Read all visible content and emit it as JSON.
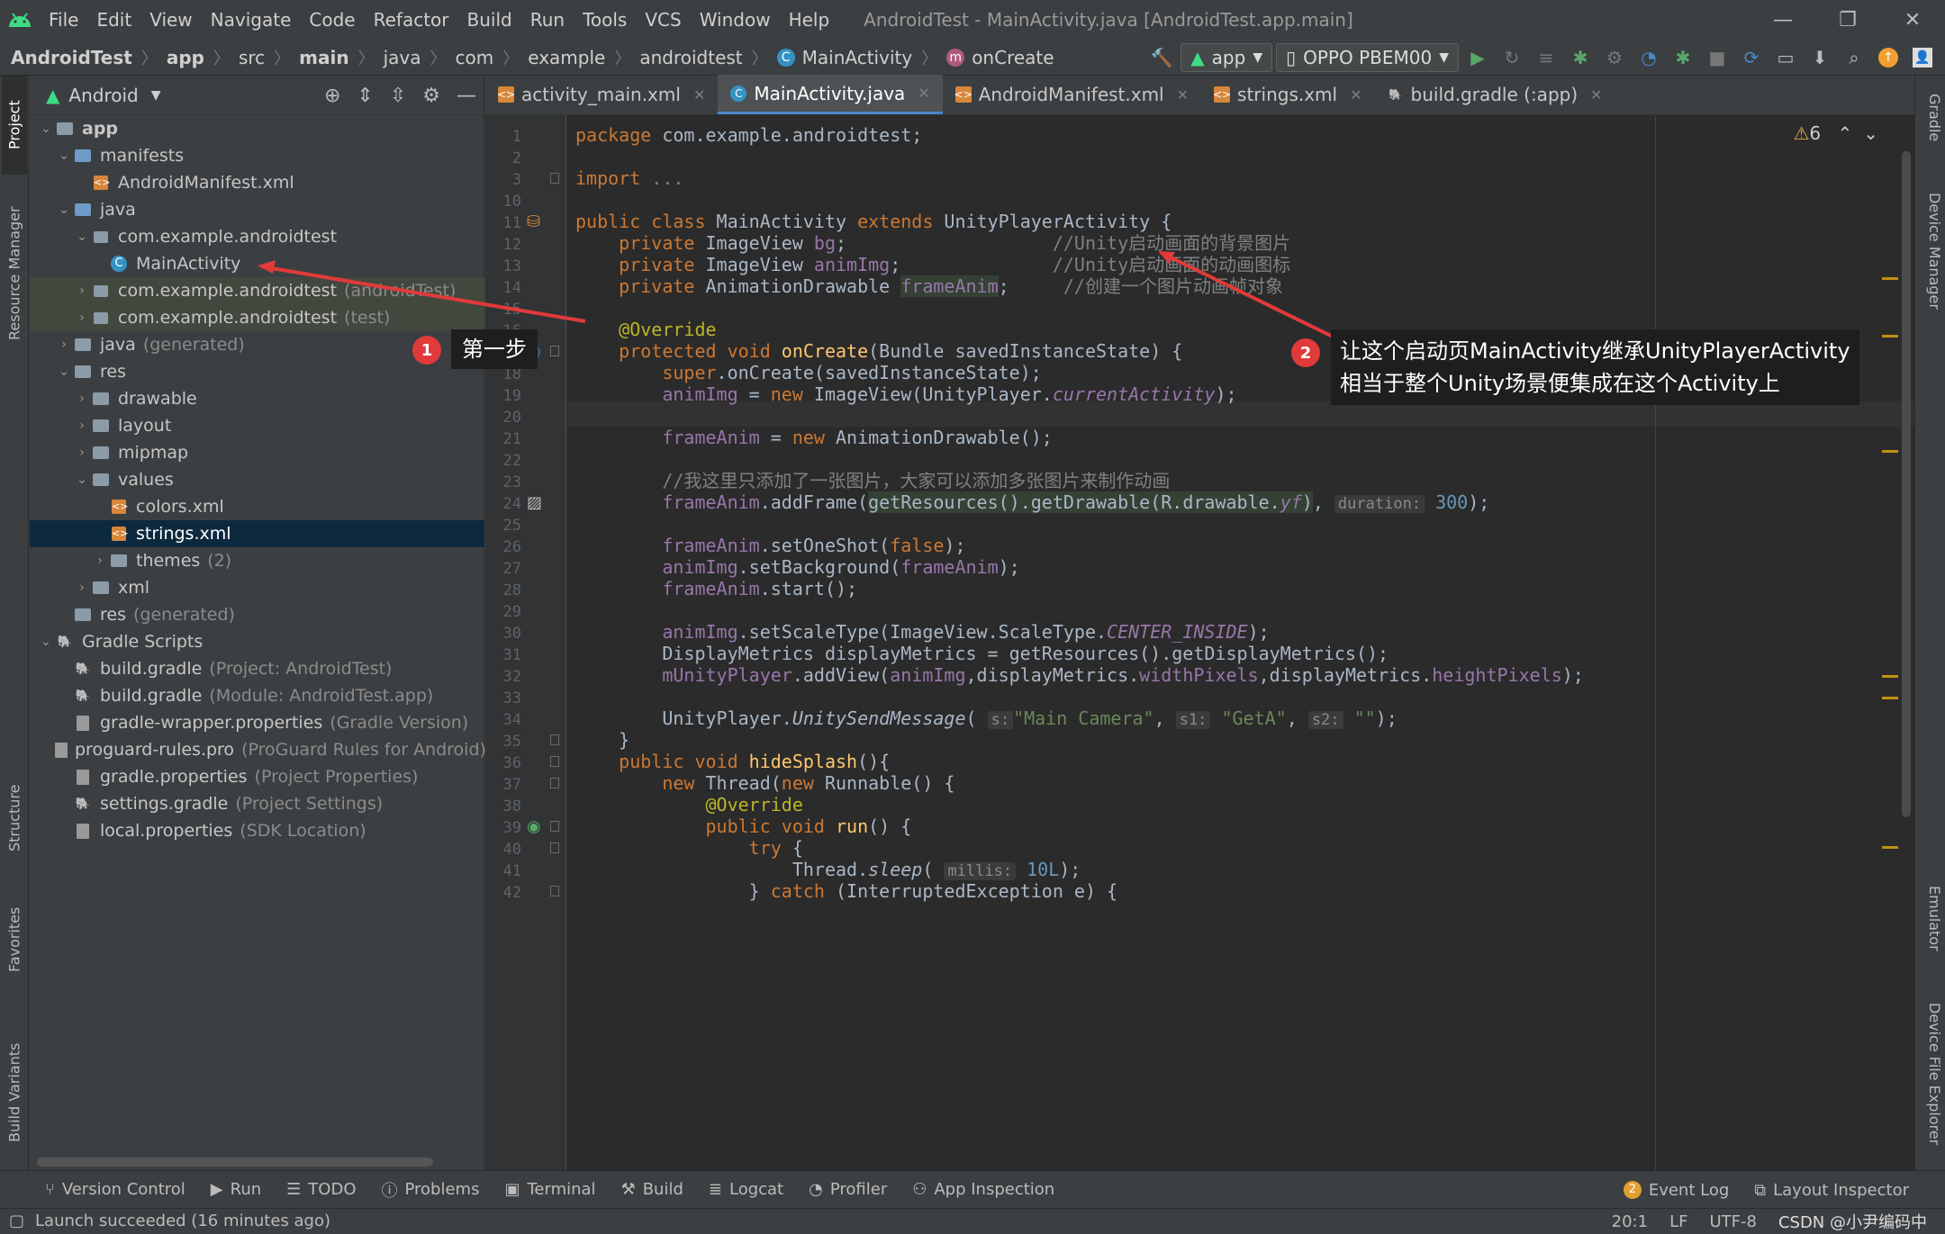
{
  "menubar": {
    "items": [
      "File",
      "Edit",
      "View",
      "Navigate",
      "Code",
      "Refactor",
      "Build",
      "Run",
      "Tools",
      "VCS",
      "Window",
      "Help"
    ],
    "window_title": "AndroidTest - MainActivity.java [AndroidTest.app.main]"
  },
  "breadcrumb": [
    "AndroidTest",
    "app",
    "src",
    "main",
    "java",
    "com",
    "example",
    "androidtest",
    "MainActivity",
    "onCreate"
  ],
  "toolbar": {
    "config": "app",
    "device": "OPPO PBEM00"
  },
  "project": {
    "view": "Android",
    "tree": [
      {
        "label": "app",
        "indent": 0,
        "arrow": "v",
        "icon": "folder",
        "bold": true
      },
      {
        "label": "manifests",
        "indent": 1,
        "arrow": "v",
        "icon": "folder-blue"
      },
      {
        "label": "AndroidManifest.xml",
        "indent": 2,
        "arrow": "",
        "icon": "xml"
      },
      {
        "label": "java",
        "indent": 1,
        "arrow": "v",
        "icon": "folder-blue"
      },
      {
        "label": "com.example.androidtest",
        "indent": 2,
        "arrow": "v",
        "icon": "package"
      },
      {
        "label": "MainActivity",
        "indent": 3,
        "arrow": "",
        "icon": "class"
      },
      {
        "label": "com.example.androidtest",
        "dim": "(androidTest)",
        "indent": 2,
        "arrow": ">",
        "icon": "package",
        "hl": true
      },
      {
        "label": "com.example.androidtest",
        "dim": "(test)",
        "indent": 2,
        "arrow": ">",
        "icon": "package",
        "hl": true
      },
      {
        "label": "java",
        "dim": "(generated)",
        "indent": 1,
        "arrow": ">",
        "icon": "folder"
      },
      {
        "label": "res",
        "indent": 1,
        "arrow": "v",
        "icon": "folder"
      },
      {
        "label": "drawable",
        "indent": 2,
        "arrow": ">",
        "icon": "folder"
      },
      {
        "label": "layout",
        "indent": 2,
        "arrow": ">",
        "icon": "folder"
      },
      {
        "label": "mipmap",
        "indent": 2,
        "arrow": ">",
        "icon": "folder"
      },
      {
        "label": "values",
        "indent": 2,
        "arrow": "v",
        "icon": "folder"
      },
      {
        "label": "colors.xml",
        "indent": 3,
        "arrow": "",
        "icon": "xml"
      },
      {
        "label": "strings.xml",
        "indent": 3,
        "arrow": "",
        "icon": "xml",
        "sel": true
      },
      {
        "label": "themes",
        "dim": "(2)",
        "indent": 3,
        "arrow": ">",
        "icon": "folder"
      },
      {
        "label": "xml",
        "indent": 2,
        "arrow": ">",
        "icon": "folder"
      },
      {
        "label": "res",
        "dim": "(generated)",
        "indent": 1,
        "arrow": "",
        "icon": "folder"
      },
      {
        "label": "Gradle Scripts",
        "indent": 0,
        "arrow": "v",
        "icon": "gradle"
      },
      {
        "label": "build.gradle",
        "dim": "(Project: AndroidTest)",
        "indent": 1,
        "arrow": "",
        "icon": "gradle"
      },
      {
        "label": "build.gradle",
        "dim": "(Module: AndroidTest.app)",
        "indent": 1,
        "arrow": "",
        "icon": "gradle"
      },
      {
        "label": "gradle-wrapper.properties",
        "dim": "(Gradle Version)",
        "indent": 1,
        "arrow": "",
        "icon": "props"
      },
      {
        "label": "proguard-rules.pro",
        "dim": "(ProGuard Rules for Android)",
        "indent": 1,
        "arrow": "",
        "icon": "props"
      },
      {
        "label": "gradle.properties",
        "dim": "(Project Properties)",
        "indent": 1,
        "arrow": "",
        "icon": "props"
      },
      {
        "label": "settings.gradle",
        "dim": "(Project Settings)",
        "indent": 1,
        "arrow": "",
        "icon": "gradle"
      },
      {
        "label": "local.properties",
        "dim": "(SDK Location)",
        "indent": 1,
        "arrow": "",
        "icon": "props"
      }
    ]
  },
  "left_tabs": [
    "Project",
    "Resource Manager",
    "Structure",
    "Favorites",
    "Build Variants"
  ],
  "right_tabs": [
    "Gradle",
    "Device Manager",
    "Emulator",
    "Device File Explorer"
  ],
  "editor_tabs": [
    {
      "label": "activity_main.xml",
      "icon": "xml"
    },
    {
      "label": "MainActivity.java",
      "icon": "class",
      "active": true
    },
    {
      "label": "AndroidManifest.xml",
      "icon": "xml"
    },
    {
      "label": "strings.xml",
      "icon": "xml"
    },
    {
      "label": "build.gradle (:app)",
      "icon": "gradle"
    }
  ],
  "warnings": "6",
  "line_numbers": [
    "1",
    "2",
    "3",
    "10",
    "11",
    "12",
    "13",
    "14",
    "15",
    "16",
    "17",
    "18",
    "19",
    "20",
    "21",
    "22",
    "23",
    "24",
    "25",
    "26",
    "27",
    "28",
    "29",
    "30",
    "31",
    "32",
    "33",
    "34",
    "35",
    "36",
    "37",
    "38",
    "39",
    "40",
    "41",
    "42"
  ],
  "code": [
    [
      [
        "kw",
        "package "
      ],
      [
        "",
        "com.example.androidtest;"
      ]
    ],
    [],
    [
      [
        "kw",
        "import "
      ],
      [
        "cm",
        "..."
      ]
    ],
    [],
    [
      [
        "kw",
        "public class "
      ],
      [
        "",
        "MainActivity "
      ],
      [
        "kw",
        "extends "
      ],
      [
        "",
        "UnityPlayerActivity {"
      ]
    ],
    [
      [
        "",
        "    "
      ],
      [
        "kw",
        "private "
      ],
      [
        "",
        "ImageView "
      ],
      [
        "fd",
        "bg"
      ],
      [
        "",
        ";                   "
      ],
      [
        "cm",
        "//Unity启动画面的背景图片"
      ]
    ],
    [
      [
        "",
        "    "
      ],
      [
        "kw",
        "private "
      ],
      [
        "",
        "ImageView "
      ],
      [
        "fd",
        "animImg"
      ],
      [
        "",
        ";              "
      ],
      [
        "cm",
        "//Unity启动画面的动画图标"
      ]
    ],
    [
      [
        "",
        "    "
      ],
      [
        "kw",
        "private "
      ],
      [
        "",
        "AnimationDrawable "
      ],
      [
        "fd hlw",
        "frameAnim"
      ],
      [
        "",
        ";     "
      ],
      [
        "cm",
        "//创建一个图片动画帧对象"
      ]
    ],
    [],
    [
      [
        "",
        "    "
      ],
      [
        "an",
        "@Override"
      ]
    ],
    [
      [
        "",
        "    "
      ],
      [
        "kw",
        "protected void "
      ],
      [
        "fn",
        "onCreate"
      ],
      [
        "",
        "(Bundle savedInstanceState) {"
      ]
    ],
    [
      [
        "",
        "        "
      ],
      [
        "kw",
        "super"
      ],
      [
        "",
        ".onCreate(savedInstanceState);"
      ]
    ],
    [
      [
        "",
        "        "
      ],
      [
        "fd",
        "animImg"
      ],
      [
        "",
        " = "
      ],
      [
        "kw",
        "new "
      ],
      [
        "",
        "ImageView(UnityPlayer."
      ],
      [
        "fd it",
        "currentActivity"
      ],
      [
        "",
        ");"
      ]
    ],
    [],
    [
      [
        "",
        "        "
      ],
      [
        "fd",
        "frameAnim"
      ],
      [
        "",
        " = "
      ],
      [
        "kw",
        "new "
      ],
      [
        "",
        "AnimationDrawable();"
      ]
    ],
    [],
    [
      [
        "",
        "        "
      ],
      [
        "cm",
        "//我这里只添加了一张图片，大家可以添加多张图片来制作动画"
      ]
    ],
    [
      [
        "",
        "        "
      ],
      [
        "fd",
        "frameAnim"
      ],
      [
        "",
        ".addFrame("
      ],
      [
        "hlw",
        "getResources().getDrawable(R.drawable."
      ],
      [
        "fd it hlw",
        "yf"
      ],
      [
        "hlw",
        ")"
      ],
      [
        "",
        ", "
      ],
      [
        "hint",
        "duration:"
      ],
      [
        "",
        " "
      ],
      [
        "num",
        "300"
      ],
      [
        "",
        ");"
      ]
    ],
    [],
    [
      [
        "",
        "        "
      ],
      [
        "fd",
        "frameAnim"
      ],
      [
        "",
        ".setOneShot("
      ],
      [
        "kw",
        "false"
      ],
      [
        "",
        ");"
      ]
    ],
    [
      [
        "",
        "        "
      ],
      [
        "fd",
        "animImg"
      ],
      [
        "",
        ".setBackground("
      ],
      [
        "fd",
        "frameAnim"
      ],
      [
        "",
        ");"
      ]
    ],
    [
      [
        "",
        "        "
      ],
      [
        "fd",
        "frameAnim"
      ],
      [
        "",
        ".start();"
      ]
    ],
    [],
    [
      [
        "",
        "        "
      ],
      [
        "fd",
        "animImg"
      ],
      [
        "",
        ".setScaleType(ImageView.ScaleType."
      ],
      [
        "fd it",
        "CENTER_INSIDE"
      ],
      [
        "",
        ");"
      ]
    ],
    [
      [
        "",
        "        "
      ],
      [
        "",
        "DisplayMetrics displayMetrics = getResources().getDisplayMetrics();"
      ]
    ],
    [
      [
        "",
        "        "
      ],
      [
        "fd",
        "mUnityPlayer"
      ],
      [
        "",
        ".addView("
      ],
      [
        "fd",
        "animImg"
      ],
      [
        "",
        ",displayMetrics."
      ],
      [
        "fd",
        "widthPixels"
      ],
      [
        "",
        ",displayMetrics."
      ],
      [
        "fd",
        "heightPixels"
      ],
      [
        "",
        ");"
      ]
    ],
    [],
    [
      [
        "",
        "        "
      ],
      [
        "",
        "UnityPlayer."
      ],
      [
        "it",
        "UnitySendMessage"
      ],
      [
        "",
        "( "
      ],
      [
        "hint",
        "s:"
      ],
      [
        "",
        ""
      ],
      [
        "st",
        "\"Main Camera\""
      ],
      [
        "",
        ", "
      ],
      [
        "hint",
        "s1:"
      ],
      [
        "",
        " "
      ],
      [
        "st",
        "\"GetA\""
      ],
      [
        "",
        ", "
      ],
      [
        "hint",
        "s2:"
      ],
      [
        "",
        " "
      ],
      [
        "st",
        "\"\""
      ],
      [
        "",
        ");"
      ]
    ],
    [
      [
        "",
        "    }"
      ]
    ],
    [
      [
        "",
        "    "
      ],
      [
        "kw",
        "public void "
      ],
      [
        "fn",
        "hideSplash"
      ],
      [
        "",
        "(){"
      ]
    ],
    [
      [
        "",
        "        "
      ],
      [
        "kw",
        "new "
      ],
      [
        "",
        "Thread("
      ],
      [
        "kw",
        "new "
      ],
      [
        "",
        "Runnable() {"
      ]
    ],
    [
      [
        "",
        "            "
      ],
      [
        "an",
        "@Override"
      ]
    ],
    [
      [
        "",
        "            "
      ],
      [
        "kw",
        "public void "
      ],
      [
        "fn",
        "run"
      ],
      [
        "",
        "() {"
      ]
    ],
    [
      [
        "",
        "                "
      ],
      [
        "kw",
        "try "
      ],
      [
        "",
        "{"
      ]
    ],
    [
      [
        "",
        "                    "
      ],
      [
        "",
        "Thread."
      ],
      [
        "it",
        "sleep"
      ],
      [
        "",
        "( "
      ],
      [
        "hint",
        "millis:"
      ],
      [
        "",
        " "
      ],
      [
        "num",
        "10L"
      ],
      [
        "",
        ");"
      ]
    ],
    [
      [
        "",
        "                } "
      ],
      [
        "kw",
        "catch "
      ],
      [
        "",
        "(InterruptedException e) {"
      ]
    ]
  ],
  "annotations": {
    "a1_num": "1",
    "a1_text": "第一步",
    "a2_num": "2",
    "a2_line1": "让这个启动页MainActivity继承UnityPlayerActivity",
    "a2_line2": "相当于整个Unity场景便集成在这个Activity上"
  },
  "bottom_tools": [
    "Version Control",
    "Run",
    "TODO",
    "Problems",
    "Terminal",
    "Build",
    "Logcat",
    "Profiler",
    "App Inspection"
  ],
  "bottom_right": {
    "event_log_count": "2",
    "event_log": "Event Log",
    "layout_inspector": "Layout Inspector"
  },
  "status": {
    "message": "Launch succeeded (16 minutes ago)",
    "position": "20:1",
    "line_sep": "LF",
    "encoding": "UTF-8",
    "watermark": "CSDN @小尹编码中"
  },
  "colors": {
    "accent": "#4a88c7",
    "annotation_red": "#e03a3a"
  }
}
